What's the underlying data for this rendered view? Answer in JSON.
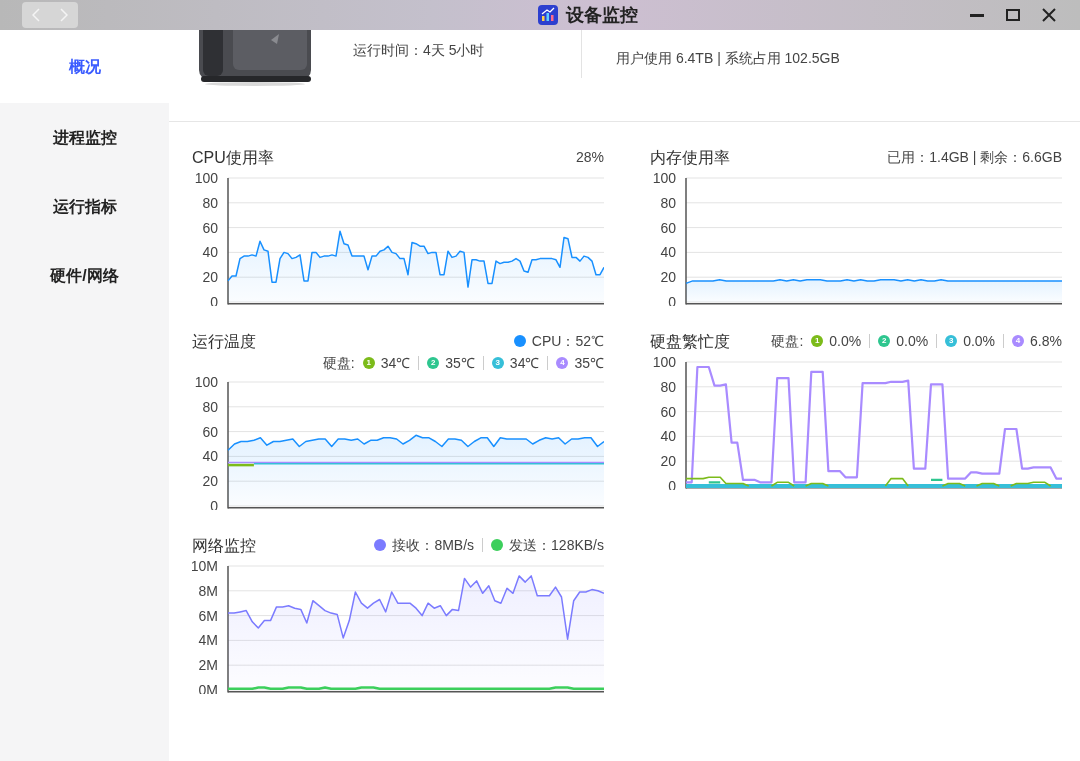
{
  "window": {
    "title": "设备监控"
  },
  "sidebar": {
    "items": [
      {
        "label": "概况",
        "selected": true
      },
      {
        "label": "进程监控",
        "selected": false
      },
      {
        "label": "运行指标",
        "selected": false
      },
      {
        "label": "硬件/网络",
        "selected": false
      }
    ]
  },
  "overview": {
    "uptime": "运行时间：4天 5小时",
    "storage": "用户使用 6.4TB | 系统占用 102.5GB"
  },
  "panels": [
    {
      "title": "CPU使用率",
      "legend_rows": [
        [
          {
            "kind": "text",
            "label": "28%"
          }
        ]
      ],
      "chart_data": {
        "type": "area",
        "grid": true,
        "ylim": [
          0,
          100
        ],
        "yticks": [
          0,
          20,
          40,
          60,
          80,
          100
        ],
        "series": [
          {
            "type": "area",
            "color": "#1890ff",
            "values": [
              17,
              21,
              21,
              35,
              37,
              37,
              38,
              37,
              49,
              42,
              41,
              16,
              16,
              35,
              40,
              39,
              35,
              36,
              38,
              17,
              17,
              40,
              40,
              36,
              37,
              37,
              38,
              37,
              57,
              47,
              46,
              37,
              37,
              37,
              37,
              26,
              37,
              37,
              41,
              42,
              45,
              40,
              39,
              35,
              35,
              22,
              48,
              47,
              45,
              45,
              39,
              40,
              40,
              22,
              22,
              41,
              36,
              37,
              41,
              40,
              12,
              34,
              34,
              33,
              33,
              15,
              15,
              33,
              31,
              32,
              32,
              33,
              35,
              33,
              25,
              24,
              34,
              34,
              35,
              35,
              35,
              35,
              34,
              28,
              52,
              51,
              36,
              36,
              33,
              37,
              36,
              33,
              22,
              22,
              28
            ]
          }
        ]
      }
    },
    {
      "title": "内存使用率",
      "legend_rows": [
        [
          {
            "kind": "text",
            "label": "已用：1.4GB | 剩余：6.6GB"
          }
        ]
      ],
      "chart_data": {
        "type": "area",
        "grid": true,
        "ylim": [
          0,
          100
        ],
        "yticks": [
          0,
          20,
          40,
          60,
          80,
          100
        ],
        "series": [
          {
            "type": "area",
            "color": "#1890ff",
            "values": [
              15,
              17,
              17,
              17,
              17,
              18,
              17,
              17,
              17,
              17,
              17,
              17,
              17,
              17,
              18,
              17,
              18,
              17,
              18,
              18,
              18,
              17,
              17,
              17,
              18,
              17,
              18,
              17,
              17,
              18,
              18,
              18,
              17,
              18,
              17,
              18,
              17,
              17,
              18,
              17,
              17,
              17,
              17,
              17,
              17,
              17,
              17,
              17,
              17,
              17,
              17,
              17,
              17,
              17,
              17,
              17,
              17
            ]
          }
        ]
      }
    },
    {
      "title": "运行温度",
      "legend_rows": [
        [
          {
            "kind": "dot",
            "label": "CPU：52℃",
            "color": "#1890ff"
          }
        ],
        [
          {
            "kind": "text",
            "label": "硬盘:"
          },
          {
            "kind": "badge",
            "number": "1",
            "label": "34℃",
            "color": "#7cbb1a"
          },
          {
            "kind": "badge",
            "number": "2",
            "label": "35℃",
            "color": "#2ec68f"
          },
          {
            "kind": "badge",
            "number": "3",
            "label": "34℃",
            "color": "#36bfd8"
          },
          {
            "kind": "badge",
            "number": "4",
            "label": "35℃",
            "color": "#a98bff"
          }
        ]
      ],
      "chart_data": {
        "type": "area",
        "grid": true,
        "ylim": [
          0,
          100
        ],
        "yticks": [
          0,
          20,
          40,
          60,
          80,
          100
        ],
        "series": [
          {
            "type": "area",
            "color": "#1890ff",
            "values": [
              45,
              50,
              52,
              52,
              53,
              55,
              49,
              52,
              52,
              53,
              54,
              48,
              52,
              53,
              54,
              54,
              48,
              54,
              54,
              53,
              54,
              50,
              53,
              53,
              55,
              55,
              54,
              50,
              53,
              57,
              55,
              55,
              52,
              48,
              54,
              54,
              53,
              48,
              52,
              55,
              55,
              48,
              55,
              54,
              54,
              54,
              54,
              50,
              53,
              55,
              54,
              55,
              50,
              54,
              54,
              55,
              55,
              48,
              52
            ]
          },
          {
            "type": "line",
            "color": "#a98bff",
            "values": [
              35,
              35,
              35,
              35,
              35,
              35,
              35,
              35,
              35,
              35,
              35,
              35,
              35,
              35,
              35,
              35,
              35,
              35,
              35,
              35,
              35,
              35,
              35,
              35,
              35,
              35,
              35,
              35,
              35,
              35,
              35,
              35,
              35,
              35,
              35,
              35,
              35,
              35,
              35,
              35,
              35,
              35,
              35,
              35,
              35,
              35,
              35,
              35,
              35,
              35,
              35,
              35,
              35,
              35,
              35,
              35,
              35,
              35,
              35
            ]
          },
          {
            "type": "line",
            "color": "#36bfd8",
            "values": [
              null,
              null,
              null,
              null,
              34,
              34,
              34,
              34,
              34,
              34,
              34,
              34,
              34,
              34,
              34,
              34,
              34,
              34,
              34,
              34,
              34,
              34,
              34,
              34,
              34,
              34,
              34,
              34,
              34,
              34,
              34,
              34,
              34,
              34,
              34,
              34,
              34,
              34,
              34,
              34,
              34,
              34,
              34,
              34,
              34,
              34,
              34,
              34,
              34,
              34,
              34,
              34,
              34,
              34,
              34,
              34,
              34,
              34,
              34
            ]
          },
          {
            "type": "line",
            "color": "#7cbb1a",
            "values": [
              33,
              33,
              33,
              33,
              33,
              null,
              null,
              null,
              null,
              null,
              null,
              null,
              null,
              null,
              null,
              null,
              null,
              null,
              null,
              null,
              null,
              null,
              null,
              null,
              null,
              null,
              null,
              null,
              null,
              null,
              null,
              null,
              null,
              null,
              null,
              null,
              null,
              null,
              null,
              null,
              null,
              null,
              null,
              null,
              null,
              null,
              null,
              null,
              null,
              null,
              null,
              null,
              null,
              null,
              null,
              null,
              null,
              null,
              null
            ]
          }
        ]
      }
    },
    {
      "title": "硬盘繁忙度",
      "legend_rows": [
        [
          {
            "kind": "text",
            "label": "硬盘:"
          },
          {
            "kind": "badge",
            "number": "1",
            "label": "0.0%",
            "color": "#7cbb1a"
          },
          {
            "kind": "badge",
            "number": "2",
            "label": "0.0%",
            "color": "#2ec68f"
          },
          {
            "kind": "badge",
            "number": "3",
            "label": "0.0%",
            "color": "#36bfd8"
          },
          {
            "kind": "badge",
            "number": "4",
            "label": "6.8%",
            "color": "#a98bff"
          }
        ]
      ],
      "chart_data": {
        "type": "line",
        "grid": true,
        "ylim": [
          0,
          100
        ],
        "yticks": [
          0,
          20,
          40,
          60,
          80,
          100
        ],
        "series": [
          {
            "type": "line",
            "color": "#36bfd8",
            "values": [
              0,
              0,
              0,
              0,
              0,
              0,
              0,
              0,
              0,
              0,
              0,
              0,
              0,
              0,
              0,
              0,
              0,
              0,
              0,
              0,
              0,
              0,
              0,
              0,
              0,
              0,
              0,
              0,
              0,
              0,
              0,
              0,
              0,
              0,
              0,
              0,
              0,
              0,
              0,
              0,
              0,
              0,
              0,
              0,
              0,
              0,
              0,
              0,
              0,
              0,
              0,
              0,
              0,
              0,
              0,
              0,
              0,
              0,
              0,
              0,
              0,
              0,
              0,
              0,
              0,
              0,
              0
            ]
          },
          {
            "type": "line",
            "color": "#a98bff",
            "values": [
              3,
              3,
              96,
              96,
              96,
              81,
              81,
              82,
              35,
              35,
              5,
              5,
              5,
              3,
              3,
              3,
              87,
              87,
              87,
              3,
              3,
              3,
              92,
              92,
              92,
              12,
              12,
              12,
              7,
              7,
              7,
              83,
              83,
              83,
              83,
              83,
              84,
              84,
              84,
              85,
              14,
              14,
              14,
              82,
              82,
              82,
              6,
              6,
              6,
              6,
              11,
              11,
              10,
              10,
              10,
              10,
              46,
              46,
              46,
              14,
              14,
              15,
              15,
              15,
              15,
              6,
              6
            ]
          },
          {
            "type": "line",
            "color": "#2ec68f",
            "values": [
              null,
              null,
              null,
              null,
              3,
              3,
              3,
              null,
              null,
              null,
              null,
              null,
              null,
              null,
              null,
              null,
              null,
              null,
              null,
              null,
              null,
              null,
              null,
              null,
              null,
              null,
              null,
              null,
              null,
              null,
              null,
              null,
              null,
              null,
              null,
              null,
              null,
              null,
              null,
              null,
              null,
              null,
              null,
              5,
              5,
              5,
              null,
              null,
              null,
              null,
              null,
              null,
              null,
              null,
              null,
              null,
              null,
              null,
              null,
              null,
              null,
              null,
              null,
              null,
              null,
              null,
              null
            ]
          },
          {
            "type": "line",
            "color": "#7cbb1a",
            "values": [
              6,
              6,
              6,
              6,
              7,
              7,
              7,
              2,
              2,
              2,
              2,
              0,
              null,
              null,
              null,
              0,
              3,
              3,
              3,
              0,
              null,
              0,
              2,
              2,
              2,
              0,
              null,
              null,
              null,
              null,
              null,
              null,
              null,
              null,
              null,
              0,
              6,
              6,
              6,
              0,
              null,
              null,
              null,
              null,
              null,
              0,
              2,
              2,
              2,
              0,
              null,
              0,
              2,
              2,
              2,
              0,
              null,
              0,
              2,
              2,
              2,
              3,
              3,
              3,
              0,
              null,
              null
            ]
          }
        ]
      }
    },
    {
      "title": "网络监控",
      "legend_rows": [
        [
          {
            "kind": "dot",
            "label": "接收：8MB/s",
            "color": "#7b7bff"
          },
          {
            "kind": "dot",
            "label": "发送：128KB/s",
            "color": "#3ccf5c"
          }
        ]
      ],
      "chart_data": {
        "type": "area",
        "grid": true,
        "ylim": [
          0,
          10
        ],
        "yticks": [
          {
            "value": 0,
            "label": "0M"
          },
          {
            "value": 2,
            "label": "2M"
          },
          {
            "value": 4,
            "label": "4M"
          },
          {
            "value": 6,
            "label": "6M"
          },
          {
            "value": 8,
            "label": "8M"
          },
          {
            "value": 10,
            "label": "10M"
          }
        ],
        "series": [
          {
            "type": "area",
            "color": "#7b7bff",
            "values": [
              6.2,
              6.2,
              6.3,
              6.4,
              5.5,
              5,
              5.6,
              5.6,
              6.7,
              6.7,
              6.8,
              6.6,
              6.5,
              5.4,
              7.2,
              6.8,
              6.4,
              6.2,
              6.1,
              4.2,
              5.6,
              7.9,
              7,
              6.6,
              7,
              7.3,
              6.3,
              7.9,
              7,
              7,
              7,
              6.6,
              6,
              7,
              6.6,
              6.8,
              6,
              6.5,
              6.4,
              9,
              8.3,
              8.8,
              7.8,
              8.4,
              7.2,
              7,
              8.2,
              7.8,
              9.2,
              8.7,
              9.2,
              7.6,
              7.6,
              7.6,
              8.3,
              7.5,
              4.1,
              7.2,
              7.9,
              7.9,
              8.1,
              8,
              7.8
            ]
          },
          {
            "type": "line",
            "color": "#3ccf5c",
            "values": [
              0.1,
              0.1,
              0.1,
              0.1,
              0.1,
              0.2,
              0.2,
              0.1,
              0.1,
              0.1,
              0.2,
              0.2,
              0.2,
              0.1,
              0.1,
              0.1,
              0.2,
              0.1,
              0.1,
              0.1,
              0.1,
              0.1,
              0.2,
              0.2,
              0.2,
              0.1,
              0.1,
              0.1,
              0.1,
              0.1,
              0.1,
              0.1,
              0.1,
              0.1,
              0.1,
              0.1,
              0.1,
              0.1,
              0.1,
              0.1,
              0.1,
              0.1,
              0.1,
              0.1,
              0.1,
              0.1,
              0.1,
              0.1,
              0.1,
              0.1,
              0.1,
              0.1,
              0.1,
              0.1,
              0.2,
              0.2,
              0.2,
              0.1,
              0.1,
              0.1,
              0.1,
              0.1,
              0.1
            ]
          }
        ]
      }
    }
  ]
}
